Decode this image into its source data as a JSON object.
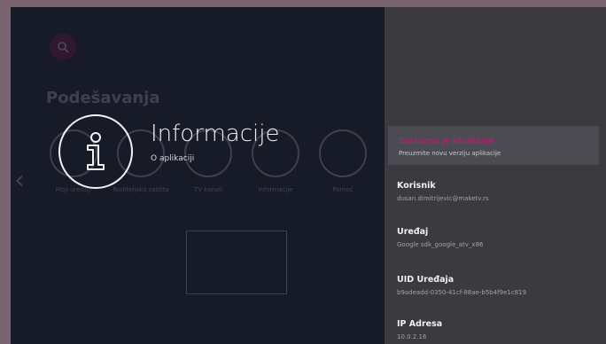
{
  "background": {
    "title": "Podešavanja",
    "tiles": [
      {
        "label": "Moji uređaji",
        "icon": "devices-icon"
      },
      {
        "label": "Roditeljska zaštita",
        "icon": "lock-icon"
      },
      {
        "label": "TV kanali",
        "icon": "tv-icon"
      },
      {
        "label": "Informacije",
        "icon": "info-icon"
      },
      {
        "label": "Pomoć",
        "icon": "help-icon"
      }
    ]
  },
  "header": {
    "title": "Informacije",
    "subtitle": "O aplikaciji",
    "icon": "info-icon"
  },
  "panel": {
    "items": [
      {
        "title": "Dostupno je ažuriranje",
        "subtitle": "Preuzmite novu verziju aplikacije"
      },
      {
        "title": "Korisnik",
        "subtitle": "dusan.dimitrijevic@maketv.rs"
      },
      {
        "title": "Uređaj",
        "subtitle": "Google sdk_google_atv_x86"
      },
      {
        "title": "UID Uređaja",
        "subtitle": "b9adeadd-0350-41cf-88ae-b5b4f9e1c819"
      },
      {
        "title": "IP Adresa",
        "subtitle": "10.0.2.16"
      }
    ]
  },
  "colors": {
    "accent": "#d4147e",
    "panel_bg": "#3a3a3f",
    "screen_bg": "#171a27"
  }
}
